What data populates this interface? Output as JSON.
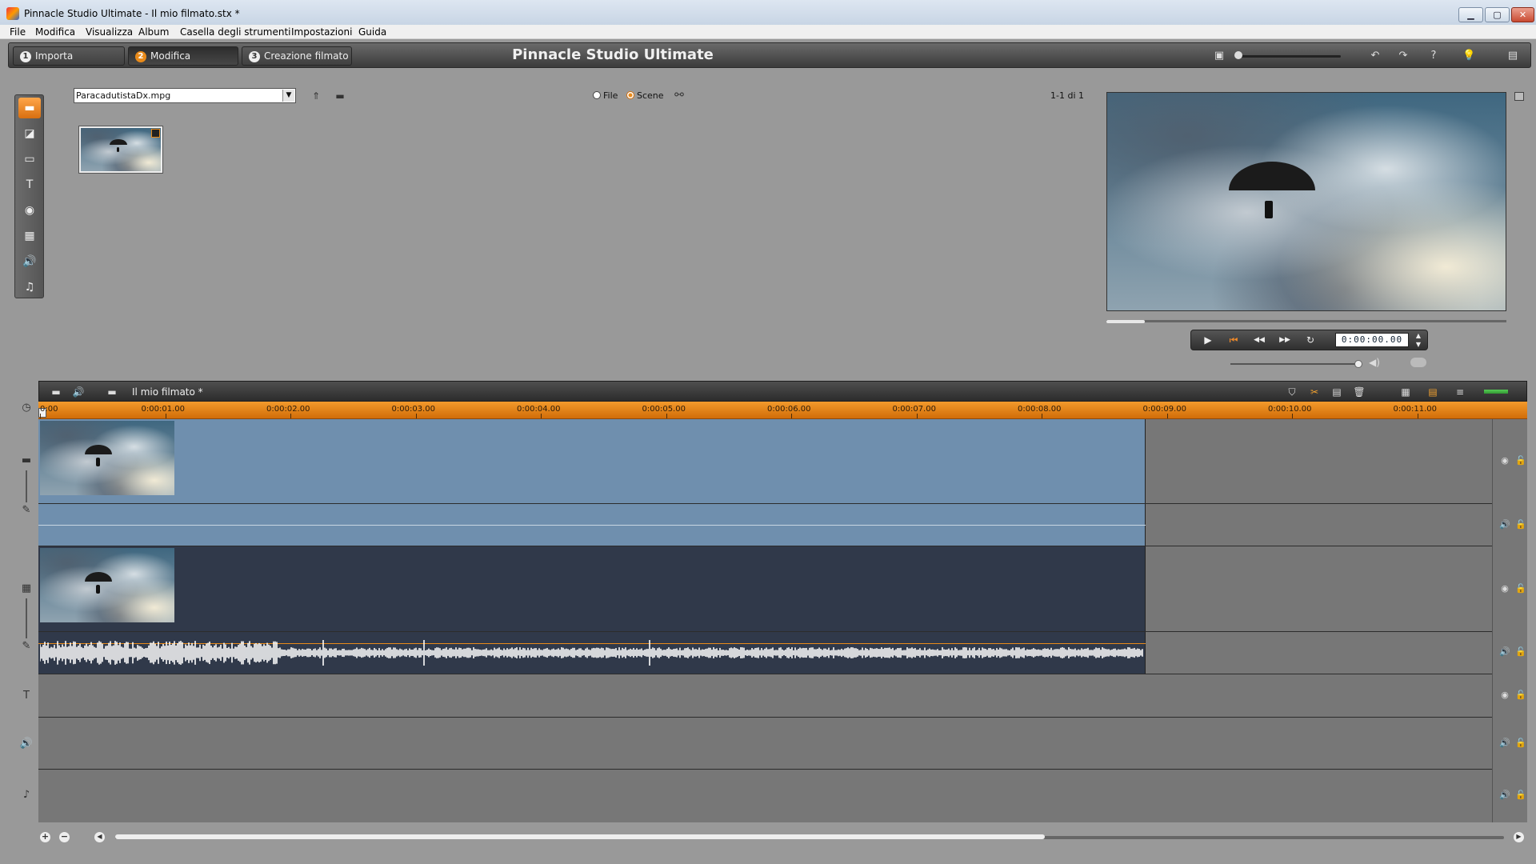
{
  "window": {
    "title": "Pinnacle Studio Ultimate - Il mio filmato.stx *",
    "minimize": "▁",
    "maximize": "▢",
    "close": "✕"
  },
  "menu": [
    "File",
    "Modifica",
    "Visualizza",
    "Album",
    "Casella degli strumenti",
    "Impostazioni",
    "Guida"
  ],
  "modes": [
    {
      "num": "1",
      "label": "Importa"
    },
    {
      "num": "2",
      "label": "Modifica"
    },
    {
      "num": "3",
      "label": "Creazione filmato"
    }
  ],
  "app_title": "Pinnacle Studio Ultimate",
  "top_icons": {
    "display": "▣",
    "undo": "↶",
    "redo": "↷",
    "help": "?",
    "tip": "💡",
    "store": "▤"
  },
  "album_tools": [
    {
      "name": "video-album-icon",
      "glyph": "▬"
    },
    {
      "name": "transitions-icon",
      "glyph": "◪"
    },
    {
      "name": "themes-icon",
      "glyph": "▭"
    },
    {
      "name": "titles-icon",
      "glyph": "T"
    },
    {
      "name": "photos-icon",
      "glyph": "◉"
    },
    {
      "name": "disc-menus-icon",
      "glyph": "▦"
    },
    {
      "name": "sound-effects-icon",
      "glyph": "🔊"
    },
    {
      "name": "music-icon",
      "glyph": "♫"
    }
  ],
  "album": {
    "file": "ParacadutistaDx.mpg",
    "dropdown_arrow": "▼",
    "up_folder_glyph": "⇑",
    "folder_glyph": "▬",
    "radio_file": "File",
    "radio_scene": "Scene",
    "view_icon": "⚯",
    "count": "1-1 di 1"
  },
  "player": {
    "timecode": "0:00:00.00",
    "play": "▶",
    "rewind_start": "⏮",
    "step_back": "◀◀",
    "step_fwd": "▶▶",
    "loop": "↻",
    "spin_up": "▲",
    "spin_down": "▼",
    "volume_glyph": "◀)"
  },
  "timeline": {
    "title": "Il mio filmato *",
    "ruler_labels": [
      "0:00",
      "0:00:01.00",
      "0:00:02.00",
      "0:00:03.00",
      "0:00:04.00",
      "0:00:05.00",
      "0:00:06.00",
      "0:00:07.00",
      "0:00:08.00",
      "0:00:09.00",
      "0:00:10.00",
      "0:00:11.00"
    ],
    "header_icons": {
      "camera": "▬",
      "audio": "🔊",
      "folder": "▬",
      "marker": "⛉",
      "razor": "✂",
      "split": "▤",
      "delete": "🗑",
      "storyboard": "▦",
      "timeline": "▤",
      "text_view": "≡"
    },
    "side_icons": {
      "clock": "◷",
      "video": "▬",
      "overlay": "▦",
      "title": "T",
      "sound": "🔊",
      "music": "♪",
      "pen": "✎"
    },
    "gutter": {
      "eye": "◉",
      "speaker": "🔊",
      "lock": "🔓"
    },
    "bottom": {
      "zoom_in": "+",
      "zoom_out": "−",
      "scroll_left": "◀",
      "scroll_right": "▶"
    }
  },
  "colors": {
    "accent": "#e88a1a",
    "video_track": "#6f8fae",
    "overlay_track": "#30394a"
  }
}
